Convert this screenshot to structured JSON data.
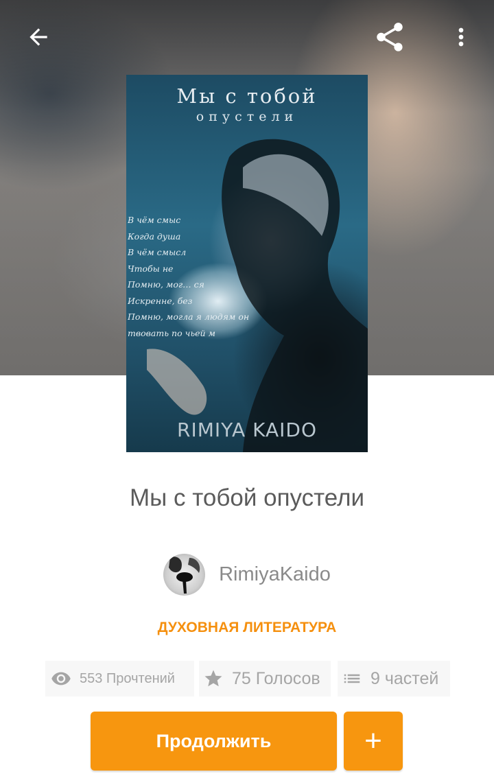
{
  "story": {
    "title": "Мы с тобой опустели",
    "author": "RimiyaKaido",
    "genre": "ДУХОВНАЯ ЛИТЕРАТУРА"
  },
  "cover": {
    "title": "Мы с тобой",
    "subtitle": "опустели",
    "author": "RIMIYA KAIDO",
    "poem_lines": [
      "В чём смыс",
      "Когда душа",
      "В чём смысл",
      "Чтобы не",
      "Помню, мог…                ся",
      "Искренне, без",
      "Помню, могла я людям он",
      "             твовать по чьей м"
    ]
  },
  "stats": {
    "reads": "553 Прочтений",
    "votes": "75 Голосов",
    "parts": "9 частей"
  },
  "buttons": {
    "continue": "Продолжить",
    "add": "+"
  },
  "icons": {
    "back": "arrow-back-icon",
    "share": "share-icon",
    "more": "more-vert-icon",
    "reads": "eye-icon",
    "votes": "star-icon",
    "parts": "list-icon"
  },
  "colors": {
    "accent": "#F7960F",
    "text_primary": "#5B5B5B",
    "text_secondary": "#A5A5A5"
  }
}
